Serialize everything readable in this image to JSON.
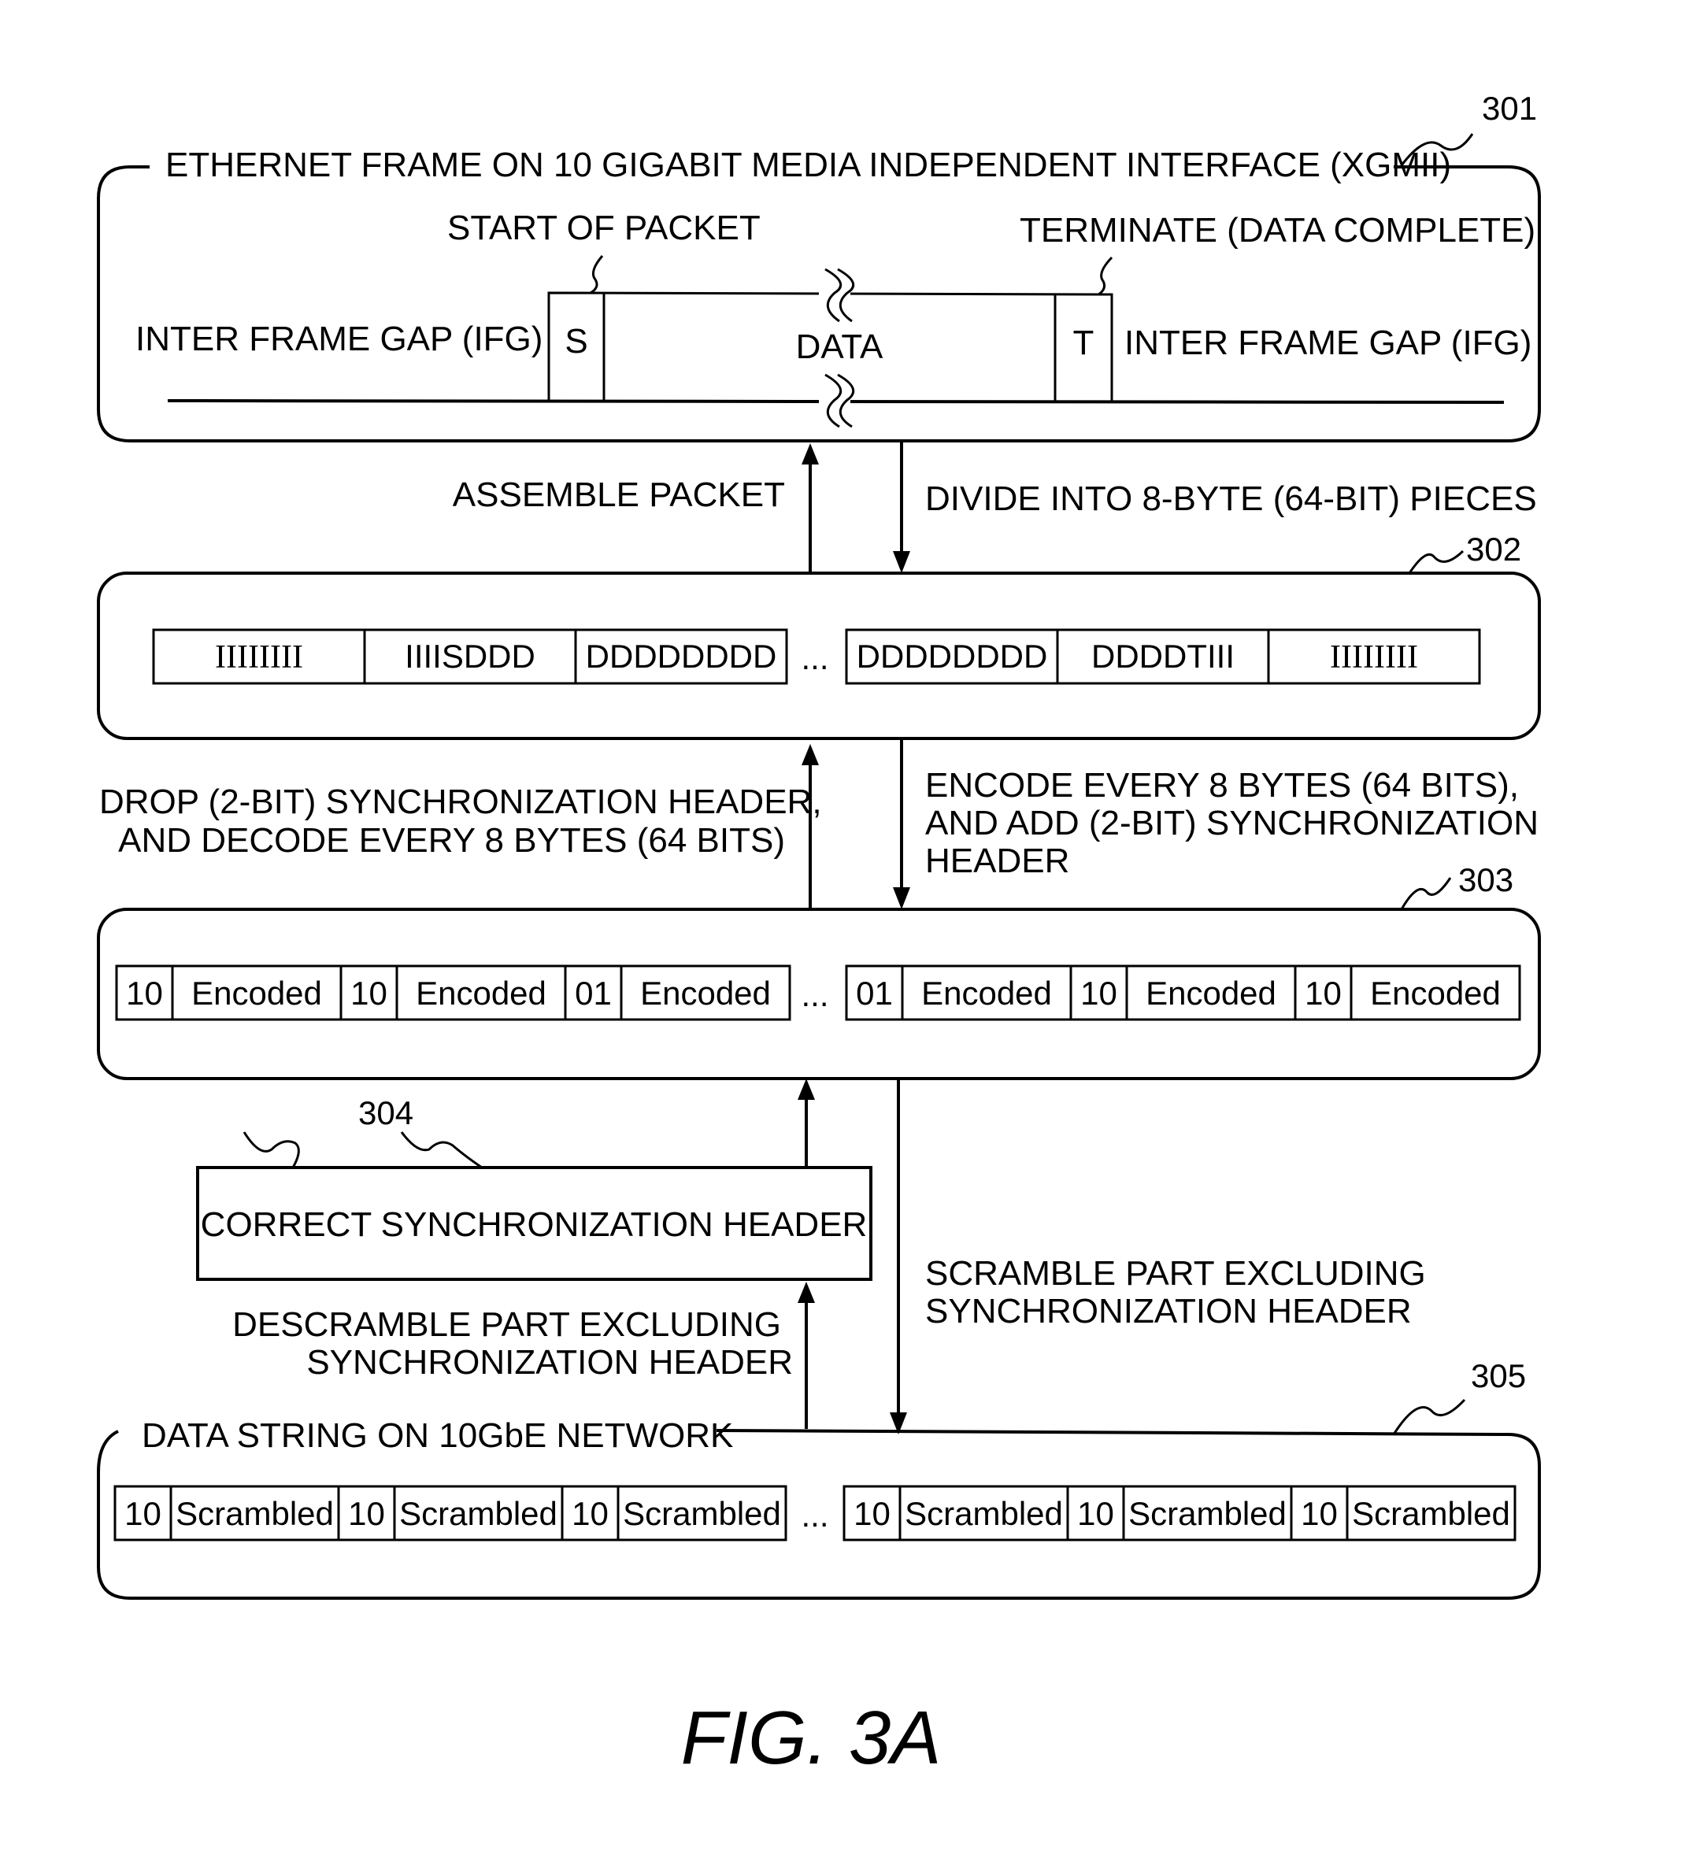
{
  "figure_label": "FIG. 3A",
  "blocks": {
    "xgmii": {
      "ref": "301",
      "title": "ETHERNET FRAME ON 10 GIGABIT MEDIA INDEPENDENT INTERFACE (XGMII)",
      "start_of_packet": "START OF PACKET",
      "terminate": "TERMINATE (DATA COMPLETE)",
      "ifg_left": "INTER FRAME GAP (IFG)",
      "ifg_right": "INTER FRAME GAP (IFG)",
      "s": "S",
      "data": "DATA",
      "t": "T"
    },
    "pieces": {
      "ref": "302",
      "cells_left": [
        "IIIIIIII",
        "IIIISDDD",
        "DDDDDDDD"
      ],
      "ellipsis": "...",
      "cells_right": [
        "DDDDDDDD",
        "DDDDTIII",
        "IIIIIIII"
      ]
    },
    "encoded": {
      "ref": "303",
      "cells_left": [
        {
          "header": "10",
          "body": "Encoded"
        },
        {
          "header": "10",
          "body": "Encoded"
        },
        {
          "header": "01",
          "body": "Encoded"
        }
      ],
      "ellipsis": "...",
      "cells_right": [
        {
          "header": "01",
          "body": "Encoded"
        },
        {
          "header": "10",
          "body": "Encoded"
        },
        {
          "header": "10",
          "body": "Encoded"
        }
      ]
    },
    "correct": {
      "ref": "304",
      "label": "CORRECT SYNCHRONIZATION HEADER"
    },
    "network": {
      "ref": "305",
      "title": "DATA STRING ON 10GbE NETWORK",
      "cells_left": [
        {
          "header": "10",
          "body": "Scrambled"
        },
        {
          "header": "10",
          "body": "Scrambled"
        },
        {
          "header": "10",
          "body": "Scrambled"
        }
      ],
      "ellipsis": "...",
      "cells_right": [
        {
          "header": "10",
          "body": "Scrambled"
        },
        {
          "header": "10",
          "body": "Scrambled"
        },
        {
          "header": "10",
          "body": "Scrambled"
        }
      ]
    }
  },
  "arrows": {
    "assemble": [
      "ASSEMBLE PACKET"
    ],
    "divide": [
      "DIVIDE INTO 8-BYTE (64-BIT) PIECES"
    ],
    "drop": [
      "DROP (2-BIT) SYNCHRONIZATION HEADER,",
      "AND DECODE EVERY 8 BYTES (64 BITS)"
    ],
    "encode": [
      "ENCODE EVERY 8 BYTES (64 BITS),",
      "AND ADD (2-BIT) SYNCHRONIZATION",
      "HEADER"
    ],
    "descramble": [
      "DESCRAMBLE PART EXCLUDING",
      "SYNCHRONIZATION HEADER"
    ],
    "scramble": [
      "SCRAMBLE PART EXCLUDING",
      "SYNCHRONIZATION HEADER"
    ]
  }
}
